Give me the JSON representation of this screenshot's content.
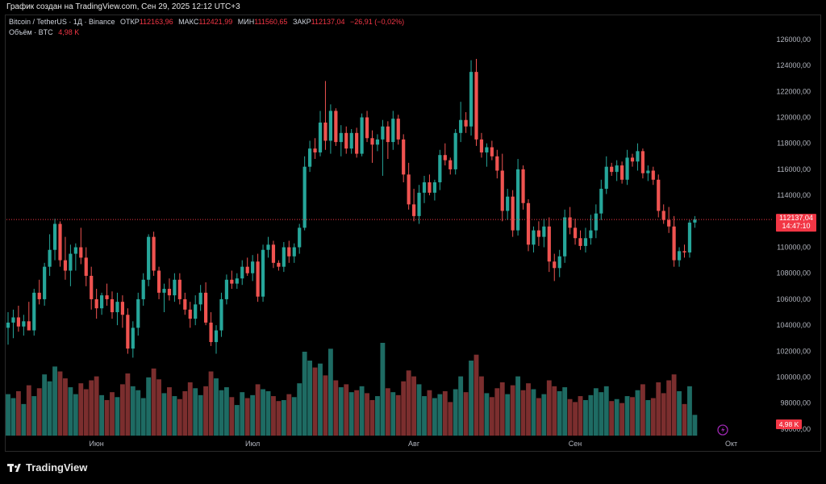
{
  "header": {
    "credit": "График создан на TradingView.com, Сен 29, 2025 12:12 UTC+3"
  },
  "legend": {
    "symbol": "Bitcoin / TetherUS · 1Д · Binance",
    "open_label": "ОТКР",
    "open": "112163,96",
    "high_label": "МАКС",
    "high": "112421,99",
    "low_label": "МИН",
    "low": "111560,65",
    "close_label": "ЗАКР",
    "close": "112137,04",
    "change": "−26,91 (−0,02%)",
    "volume_label": "Объём · BTC",
    "volume": "4,98 K"
  },
  "price_tag": {
    "price": "112137,04",
    "countdown": "14:47:10",
    "volume": "4,98 K"
  },
  "footer": {
    "logo": "TradingView"
  },
  "colors": {
    "up": "#26a69a",
    "down": "#ef5350",
    "vol_up": "#1e6b63",
    "vol_down": "#7b2e2e",
    "price_line": "#f23645"
  },
  "chart_data": {
    "type": "candlestick",
    "price_axis_ticks": [
      "126000,00",
      "124000,00",
      "122000,00",
      "120000,00",
      "118000,00",
      "116000,00",
      "114000,00",
      "112000,00",
      "110000,00",
      "108000,00",
      "106000,00",
      "104000,00",
      "102000,00",
      "100000,00",
      "98000,00",
      "96000,00"
    ],
    "ylim": [
      95500,
      126800
    ],
    "x_ticks": [
      {
        "label": "Июн",
        "index": 17
      },
      {
        "label": "Июл",
        "index": 47
      },
      {
        "label": "Авг",
        "index": 78
      },
      {
        "label": "Сен",
        "index": 109
      },
      {
        "label": "Окт",
        "index": 139
      }
    ],
    "last_price": 112137.04,
    "candles": [
      [
        103800,
        105000,
        102500,
        104200,
        4.2
      ],
      [
        104200,
        105200,
        103000,
        104600,
        3.8
      ],
      [
        104600,
        105500,
        103500,
        103900,
        4.5
      ],
      [
        103900,
        104800,
        103200,
        104300,
        3.2
      ],
      [
        104300,
        105800,
        103800,
        103600,
        5.1
      ],
      [
        103600,
        106800,
        103200,
        106500,
        4.0
      ],
      [
        106500,
        107500,
        105600,
        106000,
        4.8
      ],
      [
        106000,
        108800,
        105500,
        108500,
        6.2
      ],
      [
        108500,
        111000,
        107800,
        109800,
        5.5
      ],
      [
        109800,
        112200,
        109000,
        111800,
        7.0
      ],
      [
        111800,
        112000,
        108500,
        109000,
        6.5
      ],
      [
        109000,
        110800,
        107500,
        108200,
        5.8
      ],
      [
        108200,
        110200,
        107000,
        109500,
        4.9
      ],
      [
        109500,
        110300,
        108200,
        110000,
        4.2
      ],
      [
        110000,
        111500,
        108700,
        109200,
        5.3
      ],
      [
        109200,
        110000,
        107000,
        107800,
        4.7
      ],
      [
        107800,
        108500,
        105200,
        106000,
        5.6
      ],
      [
        106000,
        106800,
        104500,
        105300,
        6.0
      ],
      [
        105300,
        106500,
        104800,
        106300,
        4.1
      ],
      [
        106300,
        107200,
        105500,
        106000,
        3.6
      ],
      [
        106000,
        106600,
        104500,
        105000,
        4.4
      ],
      [
        105000,
        106500,
        104000,
        105800,
        3.9
      ],
      [
        105800,
        106300,
        103800,
        104800,
        5.2
      ],
      [
        104800,
        105300,
        101800,
        102200,
        6.3
      ],
      [
        102200,
        104300,
        101500,
        103800,
        5.0
      ],
      [
        103800,
        106500,
        103200,
        106000,
        4.6
      ],
      [
        106000,
        108000,
        105500,
        107500,
        3.8
      ],
      [
        107500,
        111000,
        107000,
        110800,
        5.9
      ],
      [
        110800,
        111200,
        107800,
        108200,
        6.8
      ],
      [
        108200,
        108500,
        106000,
        106500,
        5.7
      ],
      [
        106500,
        107200,
        105000,
        106800,
        4.3
      ],
      [
        106800,
        107600,
        105900,
        106300,
        4.9
      ],
      [
        106300,
        108000,
        105800,
        107500,
        4.0
      ],
      [
        107500,
        108000,
        105600,
        106000,
        3.7
      ],
      [
        106000,
        106500,
        104800,
        105200,
        4.5
      ],
      [
        105200,
        105800,
        103800,
        104500,
        5.4
      ],
      [
        104500,
        106300,
        104000,
        105600,
        4.8
      ],
      [
        105600,
        107100,
        105100,
        106500,
        4.1
      ],
      [
        106500,
        107300,
        104000,
        104200,
        5.0
      ],
      [
        104200,
        105000,
        102400,
        102700,
        6.5
      ],
      [
        102700,
        104000,
        101800,
        103600,
        5.8
      ],
      [
        103600,
        106500,
        103100,
        106000,
        4.6
      ],
      [
        106000,
        107900,
        105600,
        107500,
        4.9
      ],
      [
        107500,
        108200,
        106800,
        107200,
        3.9
      ],
      [
        107200,
        108000,
        106800,
        107600,
        3.1
      ],
      [
        107600,
        109000,
        107100,
        108500,
        4.4
      ],
      [
        108500,
        109200,
        107800,
        108000,
        3.8
      ],
      [
        108000,
        109400,
        107400,
        108900,
        4.1
      ],
      [
        108900,
        109500,
        105800,
        106200,
        5.2
      ],
      [
        106200,
        110200,
        105800,
        109800,
        4.7
      ],
      [
        109800,
        110800,
        109200,
        110200,
        4.5
      ],
      [
        110200,
        110500,
        108400,
        108800,
        4.0
      ],
      [
        108800,
        109000,
        108200,
        108500,
        3.5
      ],
      [
        108500,
        110400,
        108100,
        110000,
        3.6
      ],
      [
        110000,
        110500,
        108800,
        109300,
        4.2
      ],
      [
        109300,
        110300,
        108800,
        110000,
        3.9
      ],
      [
        110000,
        111800,
        109500,
        111500,
        5.3
      ],
      [
        111500,
        117000,
        111300,
        116200,
        8.5
      ],
      [
        116200,
        118200,
        115800,
        117600,
        7.6
      ],
      [
        117600,
        118400,
        116800,
        117300,
        6.9
      ],
      [
        117300,
        120500,
        117000,
        119600,
        7.3
      ],
      [
        119600,
        122800,
        117500,
        118200,
        6.1
      ],
      [
        118200,
        121000,
        117200,
        120500,
        8.8
      ],
      [
        120500,
        120700,
        117800,
        118100,
        5.6
      ],
      [
        118100,
        119400,
        117000,
        118800,
        4.9
      ],
      [
        118800,
        119300,
        117200,
        117600,
        5.2
      ],
      [
        117600,
        119100,
        117200,
        118800,
        4.4
      ],
      [
        118800,
        119200,
        116900,
        117200,
        4.6
      ],
      [
        117200,
        120300,
        117000,
        120000,
        5.0
      ],
      [
        120000,
        120500,
        118100,
        118400,
        4.3
      ],
      [
        118400,
        119000,
        116500,
        117900,
        3.6
      ],
      [
        117900,
        118700,
        117400,
        118300,
        4.0
      ],
      [
        118300,
        119800,
        115500,
        119300,
        9.4
      ],
      [
        119300,
        119700,
        116800,
        118100,
        4.8
      ],
      [
        118100,
        120500,
        117500,
        119900,
        4.4
      ],
      [
        119900,
        120200,
        117900,
        118300,
        4.1
      ],
      [
        118300,
        118700,
        115000,
        115600,
        5.5
      ],
      [
        115600,
        116500,
        112900,
        113300,
        6.6
      ],
      [
        113300,
        114500,
        112000,
        112400,
        6.0
      ],
      [
        112400,
        114800,
        111800,
        114200,
        5.2
      ],
      [
        114200,
        115500,
        113400,
        115000,
        4.0
      ],
      [
        115000,
        115600,
        114000,
        114200,
        4.6
      ],
      [
        114200,
        115200,
        113600,
        115000,
        3.8
      ],
      [
        115000,
        117500,
        114400,
        117100,
        4.2
      ],
      [
        117100,
        118000,
        116300,
        116700,
        4.5
      ],
      [
        116700,
        116900,
        115600,
        116000,
        3.4
      ],
      [
        116000,
        119100,
        115600,
        118800,
        4.7
      ],
      [
        118800,
        121200,
        118100,
        119800,
        6.0
      ],
      [
        119800,
        120400,
        118800,
        119300,
        4.4
      ],
      [
        119300,
        124400,
        118600,
        123500,
        7.6
      ],
      [
        123500,
        124500,
        117800,
        118300,
        8.2
      ],
      [
        118300,
        118800,
        116900,
        117300,
        6.0
      ],
      [
        117300,
        118000,
        116200,
        117700,
        4.3
      ],
      [
        117700,
        118200,
        116700,
        117000,
        3.9
      ],
      [
        117000,
        117500,
        115300,
        115900,
        4.8
      ],
      [
        115900,
        117200,
        112000,
        112800,
        5.4
      ],
      [
        112800,
        114500,
        112100,
        113900,
        4.2
      ],
      [
        113900,
        114400,
        110800,
        111300,
        5.1
      ],
      [
        111300,
        116800,
        110900,
        116000,
        6.0
      ],
      [
        116000,
        116300,
        112900,
        113400,
        4.6
      ],
      [
        113400,
        113700,
        109700,
        110200,
        5.3
      ],
      [
        110200,
        111600,
        109600,
        111300,
        4.7
      ],
      [
        111300,
        112000,
        110100,
        110800,
        3.8
      ],
      [
        110800,
        112200,
        110000,
        111600,
        4.2
      ],
      [
        111600,
        112300,
        108100,
        108900,
        5.6
      ],
      [
        108900,
        109500,
        107400,
        108400,
        5.0
      ],
      [
        108400,
        109800,
        107700,
        109300,
        4.5
      ],
      [
        109300,
        112900,
        108800,
        112300,
        4.9
      ],
      [
        112300,
        113100,
        111000,
        111500,
        3.7
      ],
      [
        111500,
        112200,
        110200,
        110700,
        3.4
      ],
      [
        110700,
        111300,
        109800,
        110100,
        4.0
      ],
      [
        110100,
        111500,
        109600,
        110700,
        3.6
      ],
      [
        110700,
        112500,
        110200,
        111300,
        4.1
      ],
      [
        111300,
        113300,
        110700,
        112600,
        4.8
      ],
      [
        112600,
        115200,
        112100,
        114500,
        4.4
      ],
      [
        114500,
        117000,
        114100,
        116200,
        5.0
      ],
      [
        116200,
        116500,
        115500,
        115800,
        3.5
      ],
      [
        115800,
        116700,
        115100,
        116300,
        3.7
      ],
      [
        116300,
        116600,
        114900,
        115200,
        3.3
      ],
      [
        115200,
        117500,
        114800,
        116900,
        4.0
      ],
      [
        116900,
        117200,
        116200,
        116600,
        3.9
      ],
      [
        116600,
        118000,
        115900,
        117400,
        4.6
      ],
      [
        117400,
        117600,
        115300,
        115700,
        5.2
      ],
      [
        115700,
        116300,
        115100,
        115900,
        3.6
      ],
      [
        115900,
        116200,
        114800,
        115200,
        3.8
      ],
      [
        115200,
        115600,
        112300,
        112800,
        5.4
      ],
      [
        112800,
        113300,
        111800,
        112100,
        4.3
      ],
      [
        112100,
        113100,
        111100,
        111600,
        5.6
      ],
      [
        111600,
        112400,
        108500,
        109000,
        6.2
      ],
      [
        109000,
        110000,
        108500,
        109700,
        4.5
      ],
      [
        109700,
        110200,
        109200,
        109600,
        3.2
      ],
      [
        109600,
        112100,
        109200,
        111900,
        5.0
      ],
      [
        111900,
        112400,
        111500,
        112137,
        2.1
      ]
    ]
  }
}
